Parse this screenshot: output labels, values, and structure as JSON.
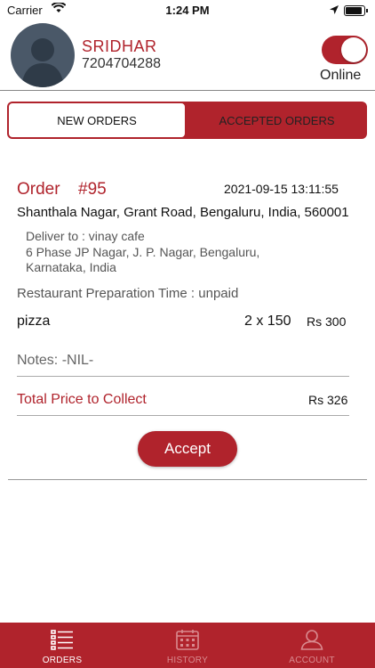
{
  "status_bar": {
    "carrier": "Carrier",
    "time": "1:24 PM"
  },
  "header": {
    "name": "SRIDHAR",
    "phone": "7204704288",
    "online_label": "Online",
    "online": true
  },
  "tabs": {
    "new_orders": "NEW ORDERS",
    "accepted_orders": "ACCEPTED ORDERS",
    "active": "new_orders"
  },
  "order": {
    "label": "Order",
    "number": "#95",
    "datetime": "2021-09-15 13:11:55",
    "address": "Shanthala Nagar, Grant Road, Bengaluru, India, 560001",
    "deliver_to_line1": "Deliver to : vinay cafe",
    "deliver_to_line2": "6 Phase JP Nagar, J. P. Nagar, Bengaluru,",
    "deliver_to_line3": "Karnataka, India",
    "prep_time": "Restaurant Preparation Time : unpaid",
    "item_name": "pizza",
    "item_qty": "2 x 150",
    "item_total": "Rs 300",
    "notes": "Notes: -NIL-",
    "total_label": "Total Price to Collect",
    "total_value": "Rs 326",
    "accept_label": "Accept"
  },
  "nav": {
    "orders": "ORDERS",
    "history": "HISTORY",
    "account": "ACCOUNT",
    "active": "orders"
  },
  "colors": {
    "brand": "#b0232c"
  }
}
